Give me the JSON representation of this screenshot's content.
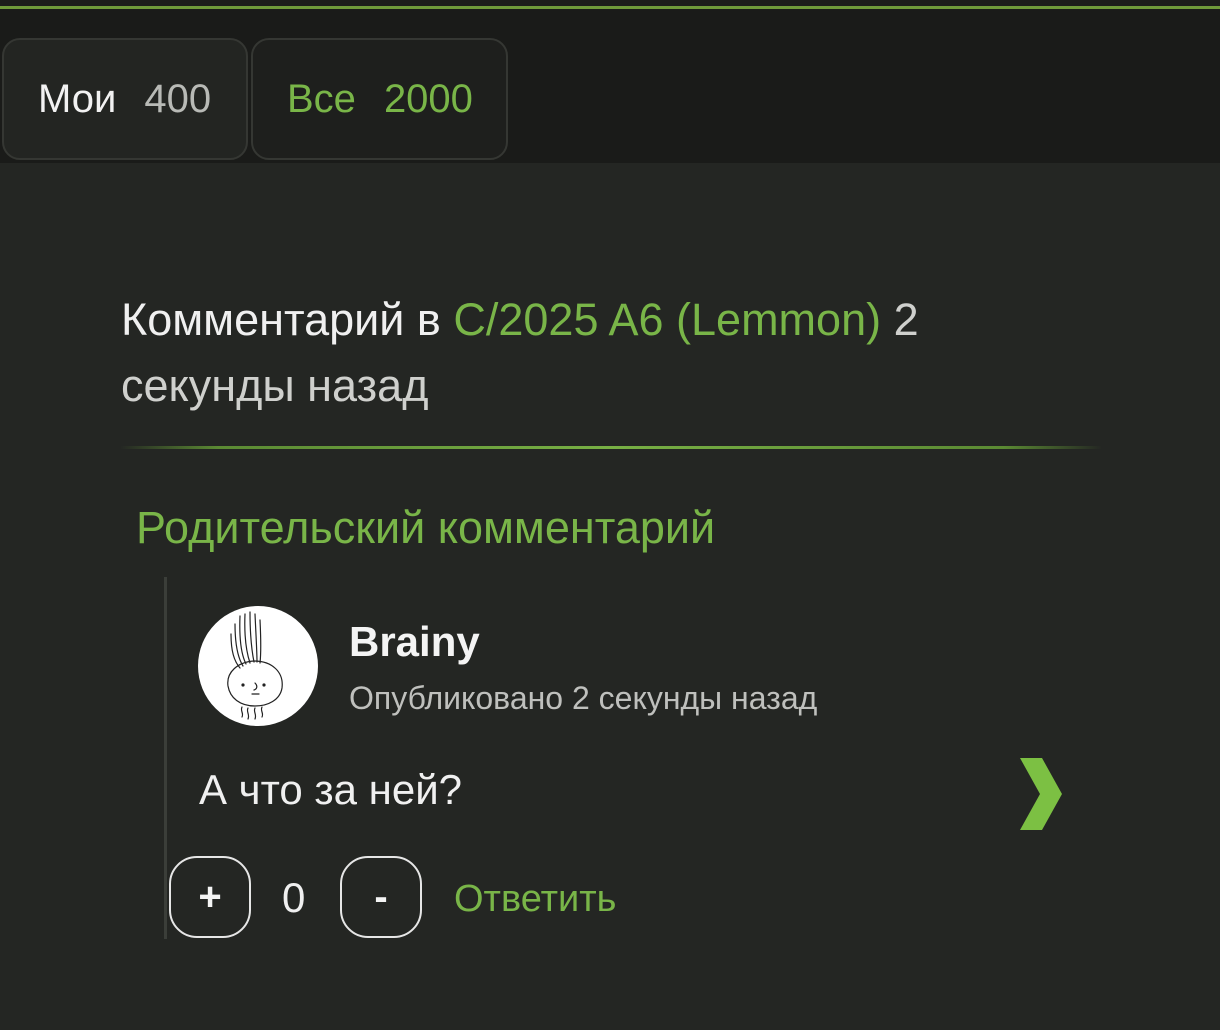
{
  "tabs": {
    "mine": {
      "label": "Мои",
      "count": "400"
    },
    "all": {
      "label": "Все",
      "count": "2000"
    }
  },
  "comment": {
    "prefix": "Комментарий в",
    "community": "C/2025 A6 (Lemmon)",
    "time": "2 секунды назад"
  },
  "parent": {
    "heading": "Родительский комментарий",
    "author": "Brainy",
    "published": "Опубликовано 2 секунды назад",
    "text": "А что за ней?",
    "score": "0",
    "upvote_label": "+",
    "downvote_label": "-",
    "reply_label": "Ответить",
    "avatar_icon": "onion-avatar",
    "next_icon": "chevron-right-icon"
  },
  "colors": {
    "accent": "#79b548",
    "background": "#242623",
    "text": "#f0f0f0"
  }
}
